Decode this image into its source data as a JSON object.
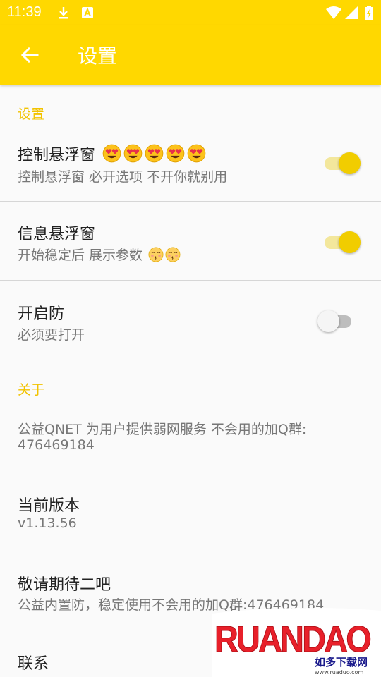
{
  "status_bar": {
    "time": "11:39",
    "left_icons": [
      "download-icon",
      "text-a-icon"
    ],
    "right_icons": [
      "wifi-icon",
      "signal-icon",
      "battery-icon"
    ]
  },
  "app_bar": {
    "title": "设置",
    "back_icon": "arrow-left-icon"
  },
  "colors": {
    "accent": "#ffd800",
    "category": "#f2c300",
    "switch_thumb_on": "#f1cd00"
  },
  "sections": {
    "settings": {
      "category": "设置",
      "float_control": {
        "title": "控制悬浮窗",
        "summary": "控制悬浮窗 必开选项 不开你就别用",
        "enabled": true,
        "emojis": 5
      },
      "float_info": {
        "title": "信息悬浮窗",
        "summary": "开始稳定后 展示参数",
        "enabled": true,
        "emojis": 2
      },
      "protection": {
        "title": "开启防",
        "summary": "必须要打开",
        "enabled": false
      }
    },
    "about": {
      "category": "关于",
      "info": {
        "line1": "公益QNET 为用户提供弱网服务 不会用的加Q群:",
        "line2": "476469184"
      },
      "version": {
        "title": "当前版本",
        "summary": "v1.13.56"
      },
      "coming": {
        "title": "敬请期待二吧",
        "summary": "公益内置防，稳定使用不会用的加Q群:476469184"
      },
      "contact": {
        "title": "联系"
      }
    }
  },
  "watermark": {
    "brand": "RUANDAO",
    "subtitle": "如多下载网",
    "url": "www.ruaduo.com"
  }
}
